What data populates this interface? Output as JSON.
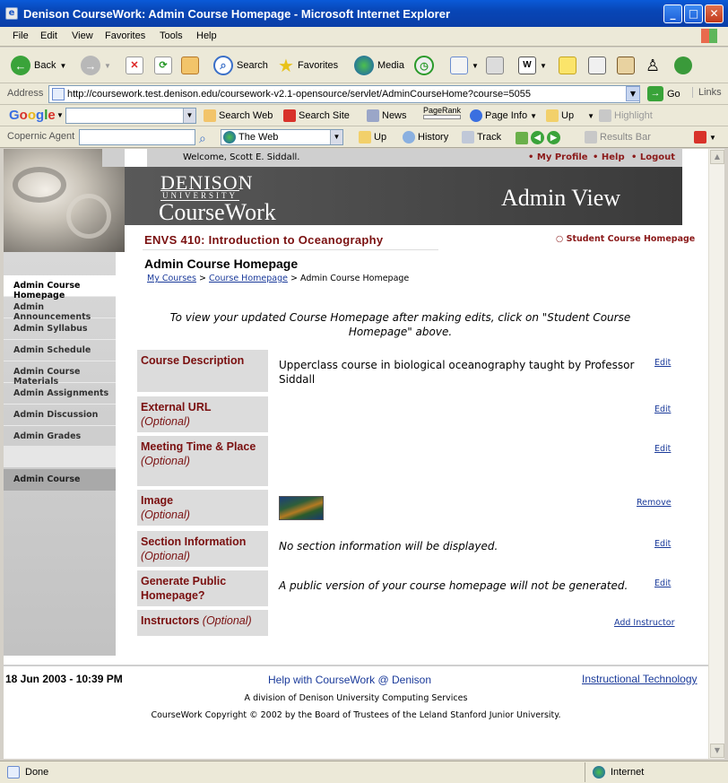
{
  "window": {
    "title": "Denison CourseWork: Admin Course Homepage - Microsoft Internet Explorer"
  },
  "menu": [
    "File",
    "Edit",
    "View",
    "Favorites",
    "Tools",
    "Help"
  ],
  "toolbar": {
    "back": "Back",
    "search": "Search",
    "favorites": "Favorites",
    "media": "Media"
  },
  "address": {
    "label": "Address",
    "url": "http://coursework.test.denison.edu/coursework-v2.1-opensource/servlet/AdminCourseHome?course=5055",
    "go": "Go",
    "links": "Links"
  },
  "google": {
    "logo": "Google",
    "search_web": "Search Web",
    "search_site": "Search Site",
    "news": "News",
    "pagerank": "PageRank",
    "page_info": "Page Info",
    "up": "Up",
    "highlight": "Highlight"
  },
  "copernic": {
    "label": "Copernic Agent",
    "scope": "The Web",
    "up": "Up",
    "history": "History",
    "track": "Track",
    "results_bar": "Results Bar"
  },
  "header": {
    "welcome": "Welcome, Scott E. Siddall.",
    "my_profile": "• My Profile",
    "help": "• Help",
    "logout": "• Logout",
    "logo_denison": "DENISON",
    "logo_university": "UNIVERSITY",
    "logo_coursework": "CourseWork",
    "view": "Admin View"
  },
  "nav": [
    {
      "label": "Admin Course Homepage"
    },
    {
      "label": "Admin Announcements"
    },
    {
      "label": "Admin Syllabus"
    },
    {
      "label": "Admin Schedule"
    },
    {
      "label": "Admin Course Materials"
    },
    {
      "label": "Admin Assignments"
    },
    {
      "label": "Admin Discussion"
    },
    {
      "label": "Admin Grades"
    },
    {
      "label": "Admin Course"
    }
  ],
  "main": {
    "course_title": "ENVS 410: Introduction to Oceanography",
    "student_link": "○ Student Course Homepage",
    "page_title": "Admin Course Homepage",
    "breadcrumb": {
      "my_courses": "My Courses",
      "sep": ">",
      "course_home": "Course Homepage",
      "current": "Admin Course Homepage"
    },
    "note": "To view your updated Course Homepage after making edits, click on \"Student Course Homepage\" above.",
    "optional": "(Optional)",
    "rows": [
      {
        "label": "Course Description",
        "value": "Upperclass course in biological oceanography taught by Professor Siddall",
        "action": "Edit"
      },
      {
        "label": "External URL",
        "value": "",
        "action": "Edit"
      },
      {
        "label": "Meeting Time & Place",
        "value": "",
        "action": "Edit"
      },
      {
        "label": "Image",
        "value": "",
        "action": "Remove"
      },
      {
        "label": "Section Information",
        "value": "No section information will be displayed.",
        "action": "Edit"
      },
      {
        "label": "Generate Public Homepage?",
        "value": "A public version of your course homepage will not be generated.",
        "action": "Edit"
      },
      {
        "label": "Instructors",
        "value": "",
        "action": "Add Instructor"
      }
    ]
  },
  "footer": {
    "date": "18 Jun 2003 - 10:39 PM",
    "help": "Help with CourseWork @ Denison",
    "it": "Instructional Technology",
    "division": "A division of Denison University Computing Services",
    "copyright": "CourseWork Copyright © 2002 by the Board of Trustees of the Leland Stanford Junior University."
  },
  "status": {
    "left": "Done",
    "zone": "Internet"
  }
}
